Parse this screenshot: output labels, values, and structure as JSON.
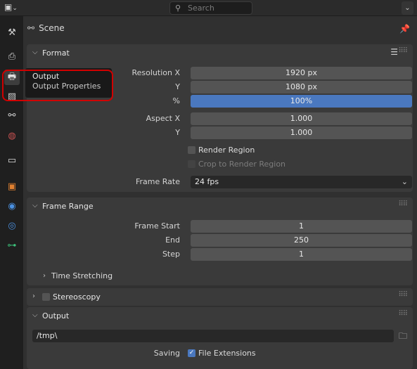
{
  "topbar": {
    "editor_icon": "properties-editor-icon",
    "search_placeholder": "Search",
    "toggle": "⌄"
  },
  "sidebar": {
    "tabs": [
      {
        "name": "tool-icon"
      },
      {
        "name": "render-icon"
      },
      {
        "name": "output-icon"
      },
      {
        "name": "view-layer-icon"
      },
      {
        "name": "scene-icon"
      },
      {
        "name": "world-icon"
      },
      {
        "name": "collection-icon"
      },
      {
        "name": "object-icon"
      },
      {
        "name": "modifiers-icon"
      },
      {
        "name": "physics-icon"
      },
      {
        "name": "object-data-icon"
      }
    ]
  },
  "header": {
    "scene_label": "Scene"
  },
  "tooltip": {
    "title": "Output",
    "subtitle": "Output Properties"
  },
  "format": {
    "title": "Format",
    "resolution_x_label": "Resolution X",
    "resolution_x": "1920 px",
    "resolution_y_label": "Y",
    "resolution_y": "1080 px",
    "percent_label": "%",
    "percent": "100%",
    "aspect_x_label": "Aspect X",
    "aspect_x": "1.000",
    "aspect_y_label": "Y",
    "aspect_y": "1.000",
    "render_region": "Render Region",
    "crop_region": "Crop to Render Region",
    "frame_rate_label": "Frame Rate",
    "frame_rate": "24 fps"
  },
  "frame_range": {
    "title": "Frame Range",
    "start_label": "Frame Start",
    "start": "1",
    "end_label": "End",
    "end": "250",
    "step_label": "Step",
    "step": "1",
    "time_stretching": "Time Stretching"
  },
  "stereoscopy": {
    "title": "Stereoscopy"
  },
  "output": {
    "title": "Output",
    "path": "/tmp\\",
    "saving_label": "Saving",
    "file_extensions": "File Extensions"
  }
}
